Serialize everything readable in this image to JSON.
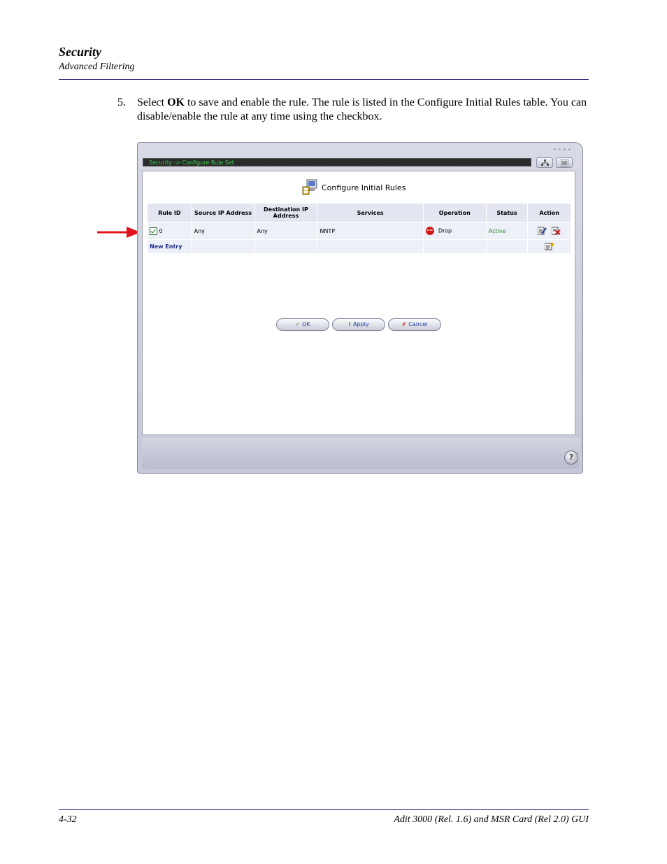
{
  "header": {
    "title": "Security",
    "subtitle": "Advanced Filtering"
  },
  "step": {
    "number": "5.",
    "text_before": "Select ",
    "bold": "OK",
    "text_after": " to save and enable the rule.  The rule is listed in the Configure Initial Rules table. You can disable/enable the rule at any time using the checkbox."
  },
  "window": {
    "breadcrumb": "Security -> Configure Rule Set",
    "page_title": "Configure Initial Rules",
    "table": {
      "headers": {
        "rule_id": "Rule ID",
        "source_ip": "Source IP Address",
        "dest_ip": "Destination IP Address",
        "services": "Services",
        "operation": "Operation",
        "status": "Status",
        "action": "Action"
      },
      "row": {
        "rule_id": "0",
        "source_ip": "Any",
        "dest_ip": "Any",
        "services": "NNTP",
        "operation": "Drop",
        "status": "Active"
      },
      "new_entry": "New Entry"
    },
    "buttons": {
      "ok": "OK",
      "apply": "Apply",
      "cancel": "Cancel"
    },
    "help_glyph": "?"
  },
  "footer": {
    "page": "4-32",
    "doc": "Adit 3000 (Rel. 1.6) and MSR Card (Rel 2.0) GUI"
  },
  "colors": {
    "rule_line": "#1a1a6e",
    "breadcrumb_text": "#35d04a",
    "arrow": "#e0141c",
    "status_active": "#2a8a2a"
  }
}
